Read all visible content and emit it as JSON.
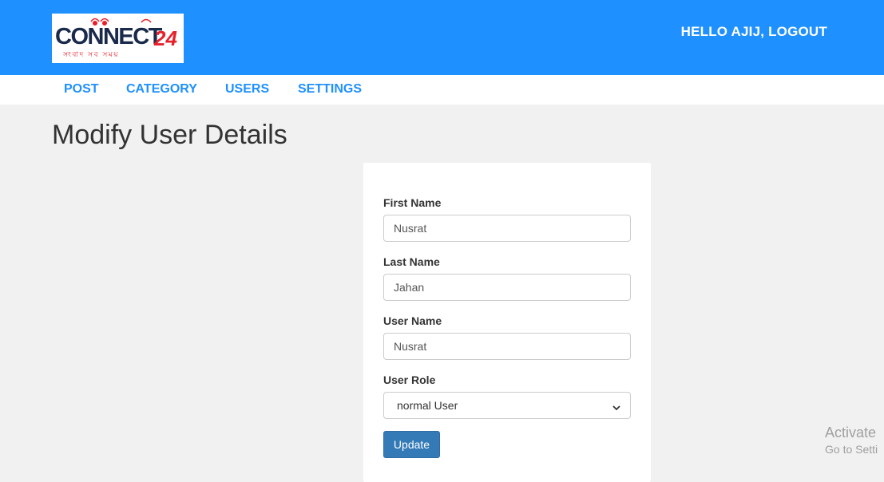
{
  "header": {
    "logo": {
      "text_main": "CONNECT",
      "text_num": "24",
      "tagline": "সংবাদ সব সময়",
      "colors": {
        "main": "#1a2a4a",
        "accent": "#e8202a"
      }
    },
    "greeting": "HELLO AJIJ, LOGOUT",
    "color": "#1e90ff"
  },
  "nav": {
    "items": [
      "POST",
      "CATEGORY",
      "USERS",
      "SETTINGS"
    ]
  },
  "page": {
    "title": "Modify User Details"
  },
  "form": {
    "first_name": {
      "label": "First Name",
      "value": "Nusrat"
    },
    "last_name": {
      "label": "Last Name",
      "value": "Jahan"
    },
    "user_name": {
      "label": "User Name",
      "value": "Nusrat"
    },
    "user_role": {
      "label": "User Role",
      "selected": "normal User",
      "icon": "chevron-down-icon"
    },
    "submit_label": "Update",
    "button_color": "#337ab7"
  },
  "watermark": {
    "line1": "Activate",
    "line2": "Go to Setti"
  }
}
